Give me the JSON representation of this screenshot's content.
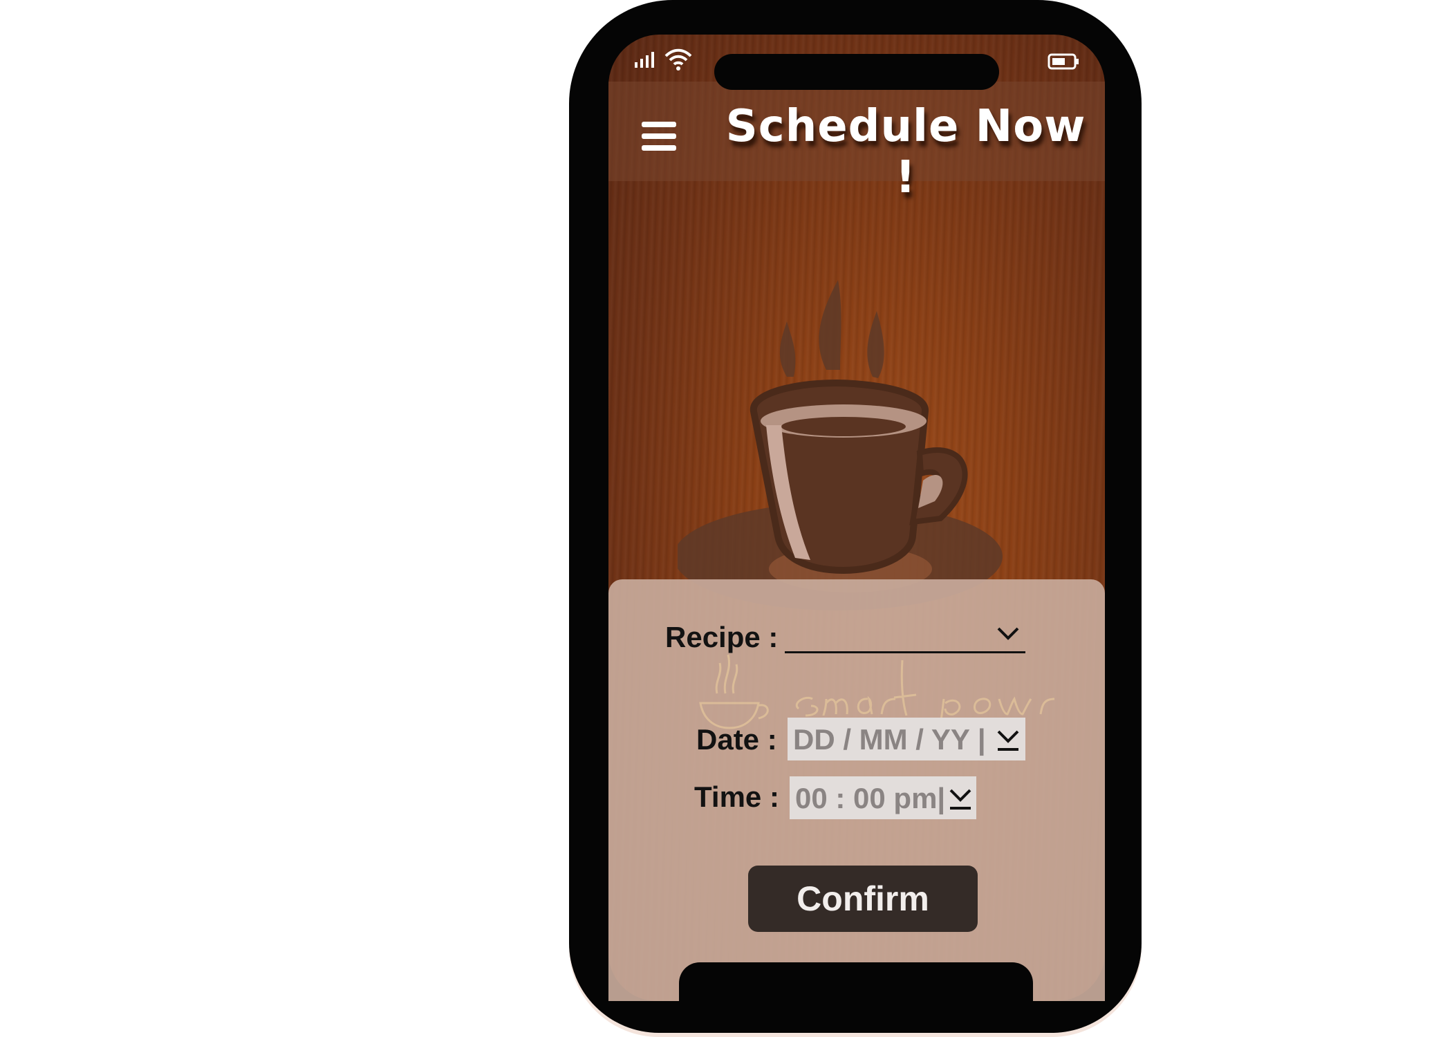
{
  "status_bar": {
    "icons": [
      "signal-icon",
      "wifi-icon",
      "battery-icon"
    ]
  },
  "header": {
    "menu_icon": "hamburger-menu-icon",
    "title": "Schedule Now !"
  },
  "hero": {
    "icon": "coffee-cup-icon"
  },
  "logo": {
    "text": "smart powr"
  },
  "form": {
    "recipe_label": "Recipe :",
    "recipe_value": "",
    "date_label": "Date :",
    "date_placeholder": "DD / MM / YY  |",
    "time_label": "Time :",
    "time_placeholder": "00 : 00 pm|",
    "confirm_label": "Confirm"
  },
  "colors": {
    "background_wood": "#8a3f15",
    "panel": "#c8aa9b",
    "button": "#342b27",
    "field": "#e2dddb"
  }
}
